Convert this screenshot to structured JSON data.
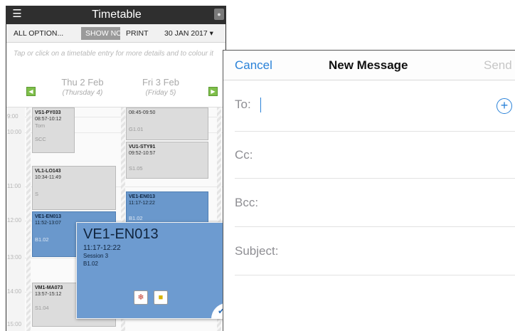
{
  "timetable": {
    "header": {
      "title": "Timetable",
      "menu_icon": "hamburger-menu-icon",
      "corner_icon": "user-icon"
    },
    "toolbar": {
      "all_options": "ALL OPTION...",
      "show": "SHOW NO",
      "print": "PRINT",
      "date": "30 JAN 2017 ▾"
    },
    "hint": "Tap or click on a timetable entry for more details and to colour it",
    "days": [
      {
        "name": "Thu 2 Feb",
        "sub": "(Thursday 4)"
      },
      {
        "name": "Fri 3 Feb",
        "sub": "(Friday 5)"
      }
    ],
    "times": [
      "9:00",
      "10:00",
      "11:00",
      "12:00",
      "13:00",
      "14:00",
      "15:00"
    ],
    "events": [
      {
        "code": "VS1-PY033",
        "time": "08:57-10:12",
        "room": "Tom"
      },
      {
        "code": "",
        "time": "",
        "room": "SCC"
      },
      {
        "code": "",
        "time": "08:45-09:50",
        "room": "G1.01"
      },
      {
        "code": "VU1-STY91",
        "time": "09:52-10:57",
        "room": "S1.05"
      },
      {
        "code": "VL1-LO143",
        "time": "10:34-11:49",
        "room": "S"
      },
      {
        "code": "VE1-EN013",
        "time": "11:17-12:22",
        "room": "B1.02"
      },
      {
        "code": "VE1-EN013",
        "time": "11:52-13:07",
        "room": "B1.02"
      },
      {
        "code": "VM1-MA073",
        "time": "13:57-15:12",
        "room": "S1.04"
      }
    ],
    "popup": {
      "code": "VE1-EN013",
      "time": "11:17-12:22",
      "session": "Session 3",
      "room": "B1.02"
    },
    "colors": {
      "header": "#2f2f2f",
      "event_blue": "#6a98cc",
      "event_grey": "#dcdcdc",
      "nav_green": "#7fbf4a"
    }
  },
  "message": {
    "cancel": "Cancel",
    "title": "New Message",
    "send": "Send",
    "to_label": "To:",
    "cc_label": "Cc:",
    "bcc_label": "Bcc:",
    "subject_label": "Subject:",
    "colors": {
      "accent": "#2a82d8",
      "label": "#8e8e93",
      "send_disabled": "#c6c6c6"
    }
  }
}
